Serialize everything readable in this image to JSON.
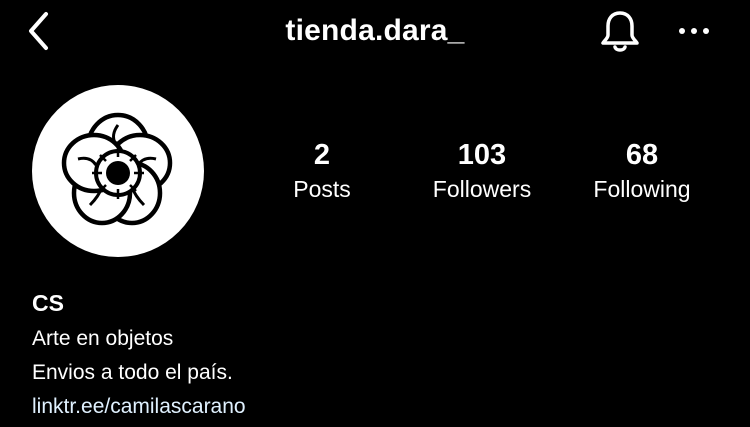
{
  "header": {
    "username": "tienda.dara_",
    "back_icon": "chevron-left-icon",
    "notification_icon": "bell-icon",
    "more_icon": "more-horizontal-icon"
  },
  "profile": {
    "avatar_icon": "flower-logo",
    "stats": [
      {
        "value": "2",
        "label": "Posts"
      },
      {
        "value": "103",
        "label": "Followers"
      },
      {
        "value": "68",
        "label": "Following"
      }
    ],
    "name": "CS",
    "bio_lines": [
      "Arte en objetos",
      "Envios a todo el país."
    ],
    "link": "linktr.ee/camilascarano"
  },
  "colors": {
    "background": "#000000",
    "text": "#ffffff",
    "link": "#e0f1ff"
  }
}
